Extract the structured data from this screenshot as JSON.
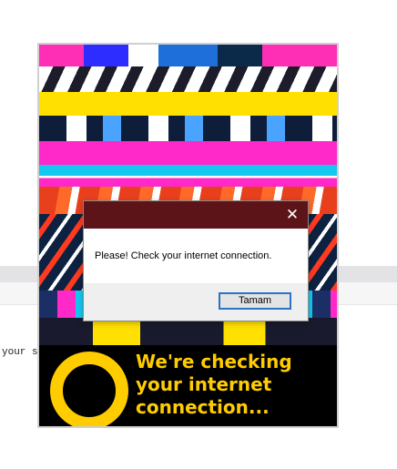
{
  "background": {
    "code_text": "your s"
  },
  "splash": {
    "banner_lines": [
      "We're checking",
      "your internet",
      "connection..."
    ],
    "accent_color": "#ffcc00"
  },
  "dialog": {
    "message": "Please! Check your internet connection.",
    "ok_label": "Tamam",
    "close_icon": "close-icon",
    "titlebar_color": "#5c1418"
  }
}
